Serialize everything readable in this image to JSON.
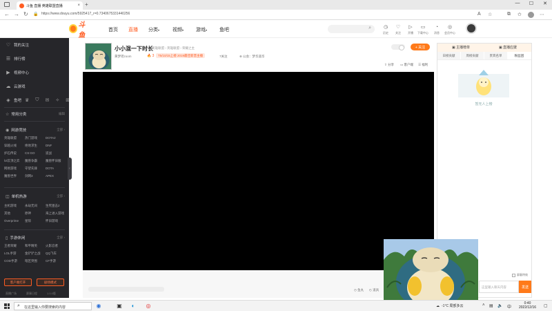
{
  "browser": {
    "tab_title": "斗鱼 直播 英雄联盟直播",
    "tab_close": "×",
    "new_tab": "+",
    "url": "https://www.douyu.com/5925417_r=0.7340675331440256",
    "win_min": "—",
    "win_max": "☐",
    "win_close": "✕"
  },
  "site": {
    "logo_text": "斗鱼",
    "nav": [
      "首页",
      "直播",
      "分类",
      "视频",
      "游戏",
      "鱼吧"
    ],
    "nav_active_index": 1,
    "header_items": [
      {
        "icon": "clock-icon",
        "glyph": "◷",
        "label": "历史"
      },
      {
        "icon": "heart-icon",
        "glyph": "♡",
        "label": "关注"
      },
      {
        "icon": "play-icon",
        "glyph": "▷",
        "label": "开播"
      },
      {
        "icon": "tv-icon",
        "glyph": "▭",
        "label": "下载中心"
      },
      {
        "icon": "bell-icon",
        "glyph": "◔",
        "label": "消息"
      },
      {
        "icon": "vip-icon",
        "glyph": "◎",
        "label": "会员中心"
      }
    ]
  },
  "sidebar": {
    "top_items": [
      {
        "icon": "heart-icon",
        "glyph": "♡",
        "label": "我的关注"
      },
      {
        "icon": "list-icon",
        "glyph": "☰",
        "label": "排行榜"
      },
      {
        "icon": "video-icon",
        "glyph": "▶",
        "label": "视频中心"
      },
      {
        "icon": "cloud-icon",
        "glyph": "☁",
        "label": "云游戏"
      },
      {
        "icon": "fish-icon",
        "glyph": "◈",
        "label": "鱼吧"
      }
    ],
    "sections": [
      {
        "title": "常用分类",
        "more": "编辑",
        "items": []
      },
      {
        "title": "网游竞技",
        "more": "全部 ›",
        "items": [
          "英雄联盟",
          "热门游戏",
          "DOTA2",
          "穿越火线",
          "绝地求生",
          "DNF",
          "炉石传说",
          "CS:GO",
          "逆战",
          "lol云顶之弈",
          "魔兽争霸",
          "魔兽怀旧服",
          "网易游戏",
          "守望先锋",
          "DOTA",
          "魔兽世界",
          "剑网3",
          "APEX"
        ]
      },
      {
        "title": "单机热游",
        "more": "全部 ›",
        "items": [
          "主机游戏",
          "永劫无间",
          "生死狙击2",
          "其他",
          "原神",
          "海上进入游戏",
          "Overprime",
          "星际",
          "怀旧游戏"
        ]
      },
      {
        "title": "手游休闲",
        "more": "全部 ›",
        "items": [
          "王者荣耀",
          "和平精英",
          "火影忍者",
          "LOL手游",
          "金铲铲之战",
          "QQ飞车",
          "COD手游",
          "暗区突围",
          "CF手游"
        ]
      }
    ],
    "btn_client": "客户端打开",
    "btn_fullscreen": "剧场模式",
    "footer": [
      "直播广场",
      "赛事日程",
      "1.0.0版"
    ],
    "toggle": "‹"
  },
  "room": {
    "title": "小小混一下时长",
    "tags": "英雄联盟 › 英雄联盟 › 荣耀之主",
    "anchor": "黄梦瑶zoom",
    "hot": "🔥 3",
    "rank": "T5/10/15上榜 2019最佳新晋主播",
    "fans": "7关注",
    "report": "⊕ 公会：梦华遥华",
    "follow_btn": "+ 关注",
    "actions": [
      "⇧ 分享",
      "▭ 客户端",
      "☰ 福利"
    ]
  },
  "below_player": {
    "items": [
      "◷ 鱼丸",
      "◴ 道具"
    ]
  },
  "right_panel": {
    "top": [
      "▣ 主播榜单",
      "▣ 直播应援"
    ],
    "tabs": [
      "日榜贡献",
      "周榜贡献",
      "贵宾名单",
      "粉丝团"
    ],
    "active_tab": 3,
    "empty_text": "暂无人上榜",
    "checkbox": "屏蔽特效",
    "chat_placeholder": "这里输入聊天内容",
    "send": "发送"
  },
  "taskbar": {
    "search_placeholder": "在这里输入你要搜索的内容",
    "weather": "-1°C  局部多云",
    "clock_time": "0:40",
    "clock_date": "2022/12/16"
  }
}
